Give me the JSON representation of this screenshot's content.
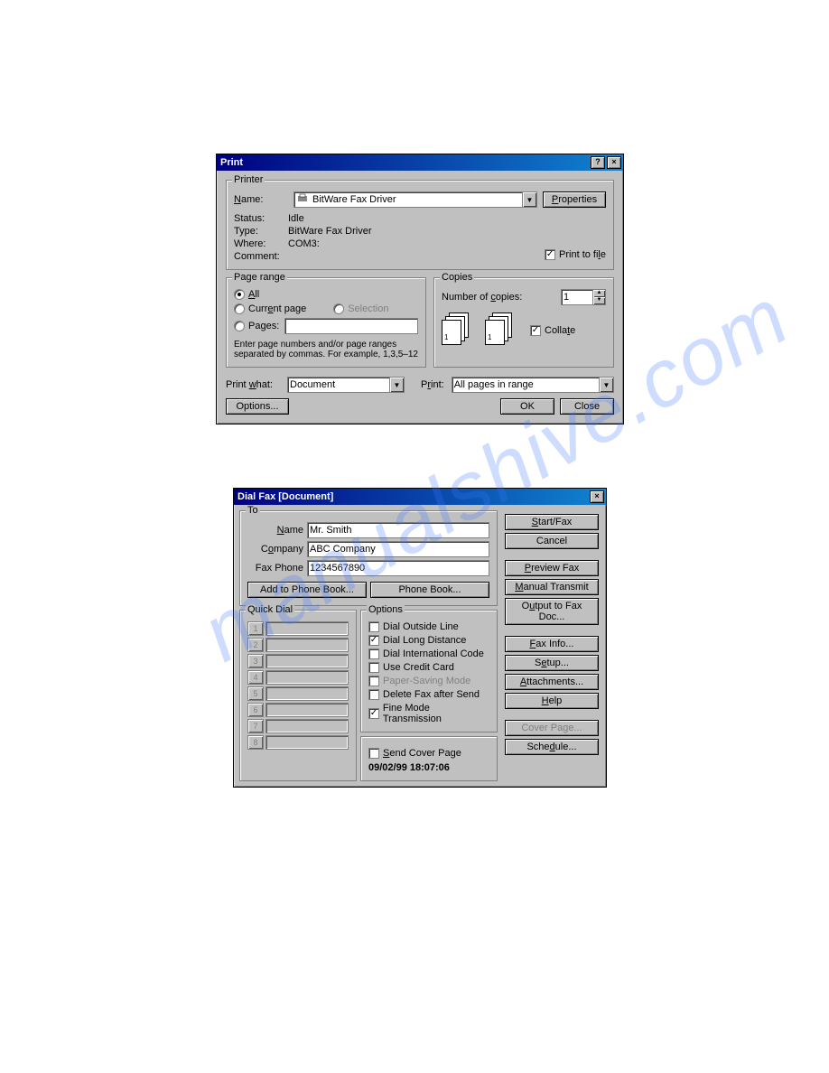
{
  "print": {
    "title": "Print",
    "printer_group": "Printer",
    "name_label": "Name:",
    "printer_name": "BitWare Fax Driver",
    "properties_btn": "Properties",
    "status_label": "Status:",
    "status_value": "Idle",
    "type_label": "Type:",
    "type_value": "BitWare Fax Driver",
    "where_label": "Where:",
    "where_value": "COM3:",
    "comment_label": "Comment:",
    "print_to_file": "Print to file",
    "page_range_group": "Page range",
    "all": "All",
    "current_page": "Current page",
    "selection": "Selection",
    "pages": "Pages:",
    "pages_hint": "Enter page numbers and/or page ranges separated by commas.  For example, 1,3,5–12",
    "copies_group": "Copies",
    "num_copies_label": "Number of copies:",
    "num_copies_value": "1",
    "collate": "Collate",
    "print_what_label": "Print what:",
    "print_what_value": "Document",
    "print_label": "Print:",
    "print_value": "All pages in range",
    "options_btn": "Options...",
    "ok_btn": "OK",
    "close_btn": "Close"
  },
  "fax": {
    "title": "Dial Fax [Document]",
    "to_group": "To",
    "name_label": "Name",
    "name_value": "Mr. Smith",
    "company_label": "Company",
    "company_value": "ABC Company",
    "phone_label": "Fax Phone",
    "phone_value": "1234567890",
    "add_phonebook_btn": "Add to Phone Book...",
    "phonebook_btn": "Phone Book...",
    "quickdial_group": "Quick Dial",
    "options_group": "Options",
    "opt_outside": "Dial Outside Line",
    "opt_long": "Dial Long Distance",
    "opt_intl": "Dial International Code",
    "opt_credit": "Use Credit Card",
    "opt_paper": "Paper-Saving Mode",
    "opt_delete": "Delete Fax after Send",
    "opt_fine": "Fine Mode Transmission",
    "send_cover": "Send Cover Page",
    "timestamp": "09/02/99 18:07:06",
    "btn_start": "Start/Fax",
    "btn_cancel": "Cancel",
    "btn_preview": "Preview Fax",
    "btn_manual": "Manual Transmit",
    "btn_output": "Output to Fax Doc...",
    "btn_info": "Eax Info...",
    "btn_setup": "Setup...",
    "btn_attach": "Attachments...",
    "btn_help": "Help",
    "btn_cover": "Cover Page...",
    "btn_sched": "Schedule..."
  }
}
